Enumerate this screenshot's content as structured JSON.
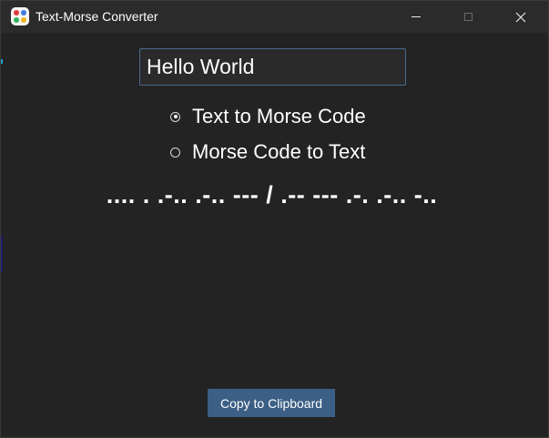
{
  "window": {
    "title": "Text-Morse Converter",
    "icon": "app-grid-dots-icon",
    "controls": [
      "minimize-icon",
      "maximize-icon",
      "close-icon"
    ]
  },
  "input": {
    "value": "Hello World"
  },
  "mode": {
    "options": [
      {
        "label": "Text to Morse Code",
        "selected": true
      },
      {
        "label": "Morse Code to Text",
        "selected": false
      }
    ]
  },
  "output": {
    "morse": ".... . .-.. .-.. --- / .-- --- .-. .-.. -.."
  },
  "actions": {
    "copy_label": "Copy to Clipboard"
  },
  "colors": {
    "background": "#232323",
    "titlebar": "#2b2b2b",
    "accent_button": "#3b5f85",
    "input_border": "#4a6a8c",
    "text": "#ffffff"
  }
}
